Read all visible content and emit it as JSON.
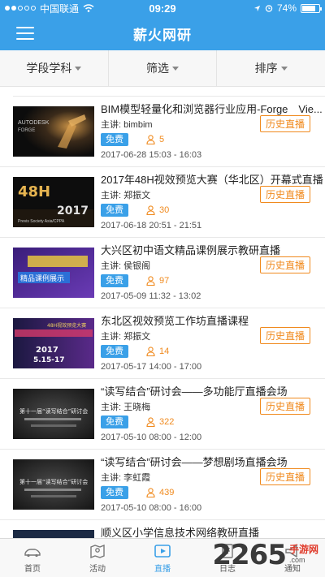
{
  "status_bar": {
    "carrier": "中国联通",
    "time": "09:29",
    "battery": "74%"
  },
  "header": {
    "title": "薪火网研"
  },
  "filters": [
    {
      "label": "学段学科"
    },
    {
      "label": "筛选"
    },
    {
      "label": "排序"
    }
  ],
  "list": {
    "speaker_prefix": "主讲: ",
    "items": [
      {
        "title": "BIM模型轻量化和浏览器行业应用-Forge　Vie...",
        "speaker": "bimbim",
        "badge": "免费",
        "viewers": "5",
        "datetime": "2017-06-28 15:03 - 16:03",
        "button": "历史直播",
        "thumb_text": [
          "AUTODESK",
          "FORGE"
        ]
      },
      {
        "title": "2017年48H视效预览大赛（华北区）开幕式直播",
        "speaker": "郑振文",
        "badge": "免费",
        "viewers": "30",
        "datetime": "2017-06-18 20:51 - 21:51",
        "button": "历史直播",
        "thumb_text": [
          "48H",
          "2017",
          "Previs Society Asia/CPPA"
        ]
      },
      {
        "title": "大兴区初中语文精品课例展示教研直播",
        "speaker": "侯银阁",
        "badge": "免费",
        "viewers": "97",
        "datetime": "2017-05-09 11:32 - 13:02",
        "button": "历史直播",
        "thumb_text": [
          "精品课例展示"
        ]
      },
      {
        "title": "东北区视效预览工作坊直播课程",
        "speaker": "郑振文",
        "badge": "免费",
        "viewers": "14",
        "datetime": "2017-05-17 14:00 - 17:00",
        "button": "历史直播",
        "thumb_text": [
          "48H视效预览大赛",
          "2017",
          "5.15-17"
        ]
      },
      {
        "title": "“读写结合”研讨会——多功能厅直播会场",
        "speaker": "王晓梅",
        "badge": "免费",
        "viewers": "322",
        "datetime": "2017-05-10 08:00 - 12:00",
        "button": "历史直播",
        "thumb_text": [
          "第十一届“读写结合”研讨会"
        ]
      },
      {
        "title": "“读写结合”研讨会——梦想剧场直播会场",
        "speaker": "李虹霞",
        "badge": "免费",
        "viewers": "439",
        "datetime": "2017-05-10 08:00 - 16:00",
        "button": "历史直播",
        "thumb_text": [
          "第十一届“读写结合”研讨会"
        ]
      },
      {
        "title": "顺义区小学信息技术网络教研直播",
        "speaker": "",
        "badge": "",
        "viewers": "",
        "datetime": "",
        "button": "",
        "thumb_text": []
      }
    ]
  },
  "tabbar": [
    {
      "label": "首页",
      "icon": "home-car-icon",
      "active": false
    },
    {
      "label": "活动",
      "icon": "map-pin-icon",
      "active": false
    },
    {
      "label": "直播",
      "icon": "live-play-icon",
      "active": true
    },
    {
      "label": "日志",
      "icon": "document-icon",
      "active": false
    },
    {
      "label": "通知",
      "icon": "megaphone-icon",
      "active": false
    }
  ],
  "watermark": {
    "digits": "2265",
    "cn": "手游网",
    "en": ".com"
  },
  "colors": {
    "primary": "#3aa0e8",
    "accent": "#f08a1e"
  }
}
